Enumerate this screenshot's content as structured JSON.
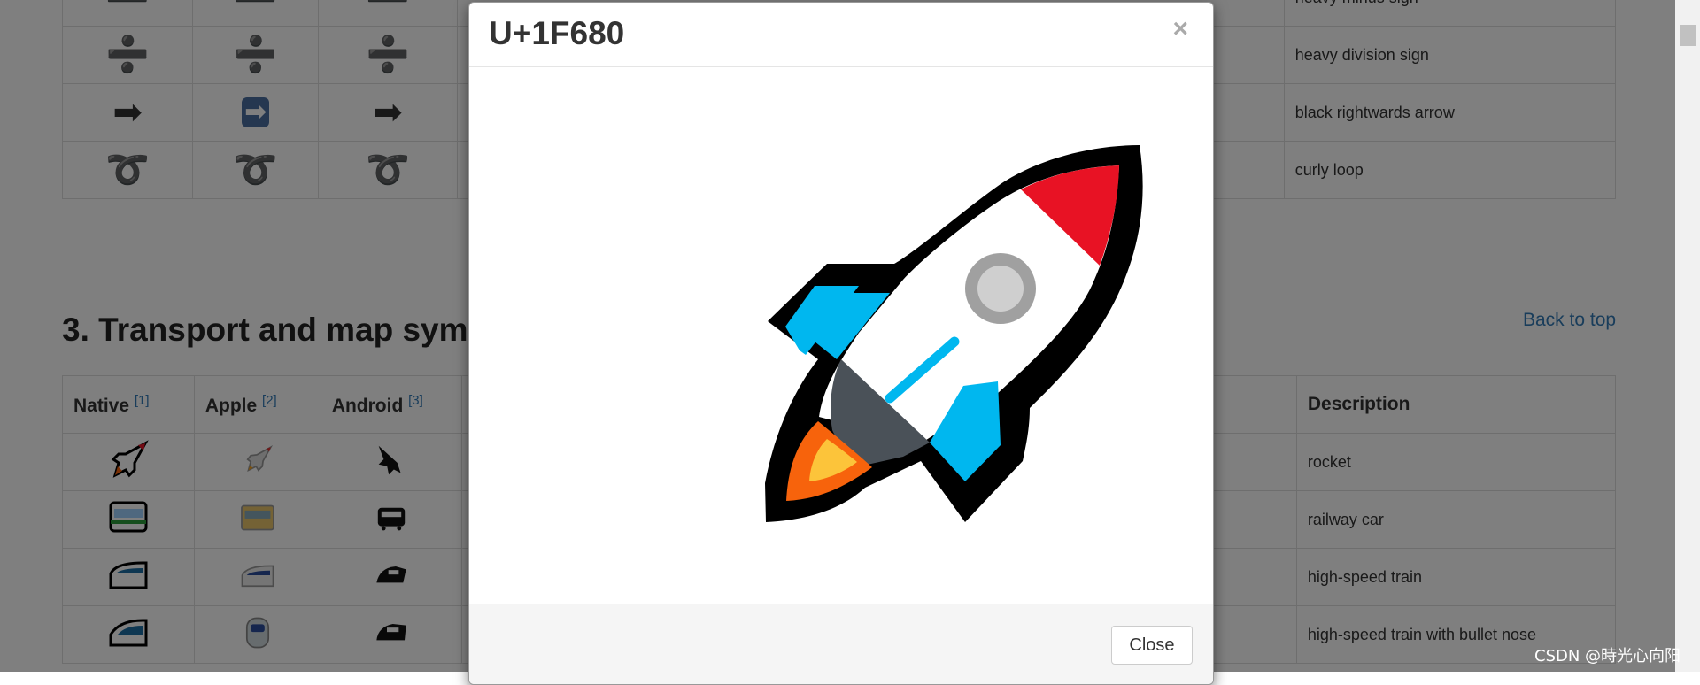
{
  "top_table": {
    "rows": [
      {
        "native": "➖",
        "apple": "➖",
        "android": "➖",
        "description": "heavy minus sign"
      },
      {
        "native": "➗",
        "apple": "➗",
        "android": "➗",
        "description": "heavy division sign"
      },
      {
        "native": "➡",
        "apple": "➡",
        "android": "➡",
        "description": "black rightwards arrow"
      },
      {
        "native": "➰",
        "apple": "➰",
        "android": "➰",
        "description": "curly loop"
      }
    ]
  },
  "section": {
    "heading": "3. Transport and map sym",
    "back_to_top": "Back to top"
  },
  "transport_table": {
    "headers": {
      "native": "Native",
      "native_ref": "[1]",
      "apple": "Apple",
      "apple_ref": "[2]",
      "android": "Android",
      "android_ref": "[3]",
      "description": "Description"
    },
    "rows": [
      {
        "icon": "rocket",
        "description": "rocket"
      },
      {
        "icon": "railway-car",
        "description": "railway car"
      },
      {
        "icon": "high-speed-train",
        "description": "high-speed train"
      },
      {
        "icon": "bullet-train",
        "description": "high-speed train with bullet nose"
      }
    ]
  },
  "modal": {
    "title": "U+1F680",
    "close_x": "×",
    "image_icon": "rocket-icon",
    "close_button": "Close"
  },
  "watermark": "CSDN @時光心向阳",
  "colors": {
    "overlay": "rgba(0,0,0,0.5)",
    "link": "#337ab7",
    "rocket_red": "#e81224",
    "rocket_blue": "#00b7ef",
    "rocket_gray": "#a0a0a0",
    "rocket_dark": "#4a5158",
    "flame_orange": "#f7630c",
    "flame_yellow": "#fcc43a"
  }
}
